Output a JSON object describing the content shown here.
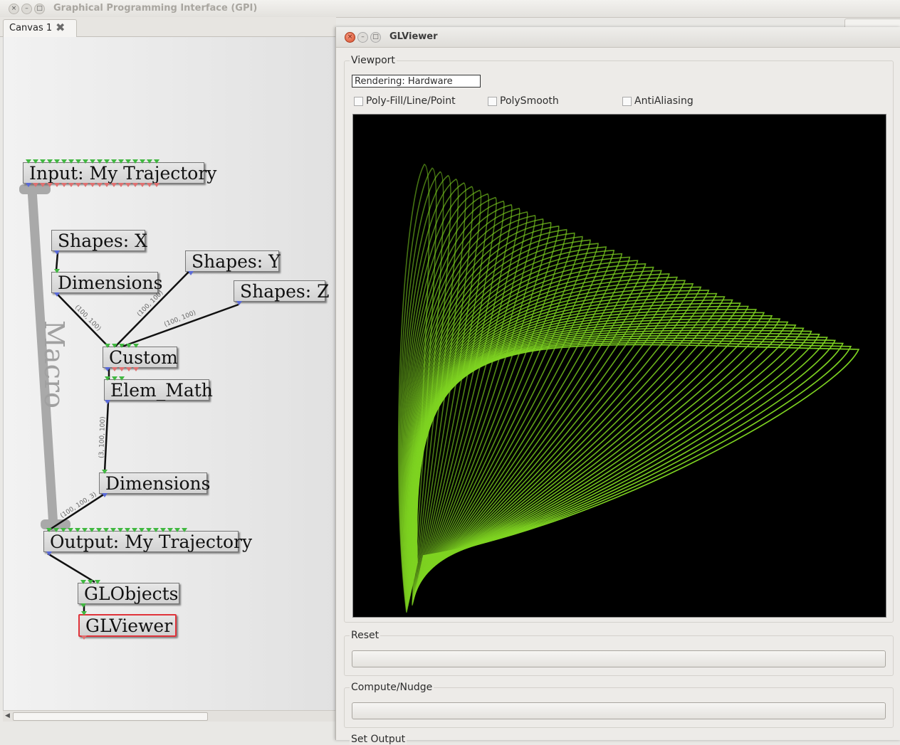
{
  "window": {
    "title": "Graphical Programming Interface (GPI)"
  },
  "tabs": [
    {
      "label": "Canvas 1"
    }
  ],
  "canvas": {
    "macro_label": "Macro",
    "nodes": {
      "input_traj": "Input: My Trajectory",
      "shapes_x": "Shapes: X",
      "dimensions_1": "Dimensions",
      "shapes_y": "Shapes: Y",
      "shapes_z": "Shapes: Z",
      "custom": "Custom",
      "elem_math": "Elem_Math",
      "dimensions_2": "Dimensions",
      "output_traj": "Output: My Trajectory",
      "globjects": "GLObjects",
      "glviewer": "GLViewer"
    },
    "edges": {
      "dim1_custom": "(100, 100)",
      "shapesy_custom": "(100, 100)",
      "shapesz_custom": "(100, 100)",
      "elem_dim2": "(3, 100, 100)",
      "dim2_output": "(100, 100, 3)"
    }
  },
  "glviewer": {
    "title": "GLViewer",
    "viewport_label": "Viewport",
    "rendering": "Rendering: Hardware",
    "checkboxes": [
      {
        "label": "Poly-Fill/Line/Point",
        "checked": false
      },
      {
        "label": "PolySmooth",
        "checked": false
      },
      {
        "label": "AntiAliasing",
        "checked": false
      }
    ],
    "reset_label": "Reset",
    "compute_label": "Compute/Nudge",
    "set_output_label": "Set Output"
  },
  "colors": {
    "render_line": "#7ed321",
    "render_bg": "#000000",
    "port_in": "#40b840",
    "port_out": "#5a6ad8",
    "selected_node_border": "#e0333a"
  }
}
